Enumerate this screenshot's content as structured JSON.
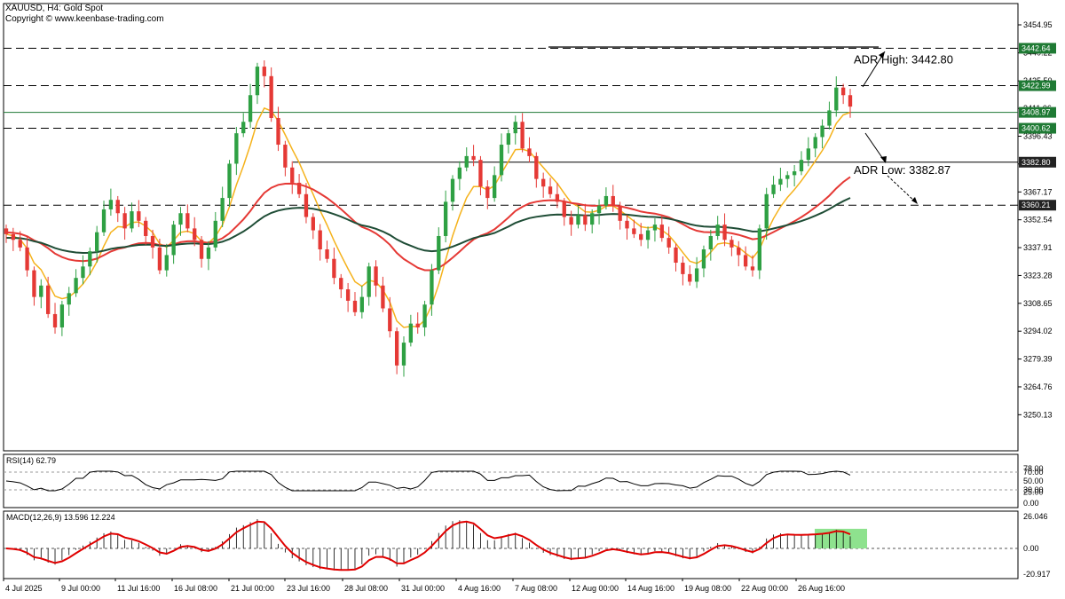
{
  "header": {
    "symbol_line": "XAUUSD, H4:  Gold Spot",
    "copyright": "Copyright © www.keenbase-trading.com"
  },
  "colors": {
    "bull": "#2ea043",
    "bear": "#e53935",
    "ema20": "#f5b21b",
    "ema100": "#e53935",
    "ema200": "#1f4d36",
    "badge_green": "#1f7a34",
    "badge_dark": "#222222",
    "macd_signal": "#e00000",
    "highlight": "#8ee28e"
  },
  "chart_data": [
    {
      "type": "candlestick",
      "title": "XAUUSD, H4: Gold Spot",
      "ylim": [
        3237,
        3468
      ],
      "y_ticks": [
        "3454.95",
        "3440.22",
        "3425.50",
        "3411.06",
        "3396.43",
        "3381.87",
        "3367.17",
        "3352.54",
        "3337.91",
        "3323.28",
        "3308.65",
        "3294.02",
        "3279.39",
        "3264.76",
        "3250.13"
      ],
      "x_ticks": [
        "4 Jul 2025",
        "9 Jul 00:00",
        "11 Jul 16:00",
        "16 Jul 08:00",
        "21 Jul 00:00",
        "23 Jul 16:00",
        "28 Jul 08:00",
        "31 Jul 00:00",
        "4 Aug 16:00",
        "7 Aug 08:00",
        "12 Aug 00:00",
        "14 Aug 16:00",
        "19 Aug 08:00",
        "22 Aug 00:00",
        "26 Aug 16:00"
      ],
      "close_path": [
        3345,
        3342,
        3338,
        3326,
        3312,
        3318,
        3303,
        3296,
        3308,
        3314,
        3322,
        3328,
        3336,
        3346,
        3358,
        3363,
        3356,
        3348,
        3357,
        3352,
        3344,
        3338,
        3326,
        3334,
        3350,
        3356,
        3348,
        3342,
        3332,
        3338,
        3352,
        3364,
        3382,
        3398,
        3404,
        3418,
        3433,
        3428,
        3406,
        3392,
        3380,
        3372,
        3366,
        3354,
        3347,
        3337,
        3332,
        3322,
        3316,
        3310,
        3304,
        3312,
        3328,
        3318,
        3306,
        3294,
        3276,
        3288,
        3298,
        3296,
        3308,
        3326,
        3344,
        3362,
        3374,
        3380,
        3386,
        3384,
        3370,
        3364,
        3376,
        3392,
        3398,
        3404,
        3390,
        3386,
        3374,
        3370,
        3366,
        3362,
        3354,
        3350,
        3355,
        3350,
        3356,
        3360,
        3365,
        3360,
        3352,
        3348,
        3345,
        3342,
        3347,
        3350,
        3343,
        3338,
        3330,
        3324,
        3320,
        3327,
        3337,
        3344,
        3350,
        3342,
        3338,
        3334,
        3328,
        3326,
        3348,
        3366,
        3371,
        3374,
        3376,
        3378,
        3384,
        3390,
        3396,
        3402,
        3410,
        3422,
        3418,
        3412
      ],
      "horizontal_levels": [
        {
          "price": 3442.64,
          "label": "3442.64",
          "style": "dashed",
          "badge": "green"
        },
        {
          "price": 3422.99,
          "label": "3422.99",
          "style": "dashed",
          "badge": "green"
        },
        {
          "price": 3408.97,
          "label": "3408.97",
          "style": "solid-green",
          "badge": "green"
        },
        {
          "price": 3400.62,
          "label": "3400.62",
          "style": "dashed",
          "badge": "green"
        },
        {
          "price": 3382.8,
          "label": "3382.80",
          "style": "solid-dark",
          "badge": "dark"
        },
        {
          "price": 3360.21,
          "label": "3360.21",
          "style": "dashed",
          "badge": "dark"
        }
      ],
      "annotations": [
        {
          "text": "ADR High: 3442.80",
          "price": 3436.5
        },
        {
          "text": "ADR Low: 3382.87",
          "price": 3378.5
        }
      ],
      "moving_averages": [
        {
          "color_key": "ema20",
          "period": 20
        },
        {
          "color_key": "ema100",
          "period": 100
        },
        {
          "color_key": "ema200",
          "period": 200
        }
      ]
    },
    {
      "type": "line",
      "label": "RSI(14) 62.79",
      "ylim": [
        0,
        100
      ],
      "y_ticks": [
        "78.00",
        "70.00",
        "50.00",
        "30.00",
        "25.00",
        "0.00"
      ],
      "levels": [
        70,
        30
      ]
    },
    {
      "type": "bar",
      "label": "MACD(12,26,9) 13.596 12.224",
      "ylim": [
        -22,
        28
      ],
      "y_ticks": [
        "26.046",
        "0.00",
        "-20.917"
      ]
    }
  ]
}
